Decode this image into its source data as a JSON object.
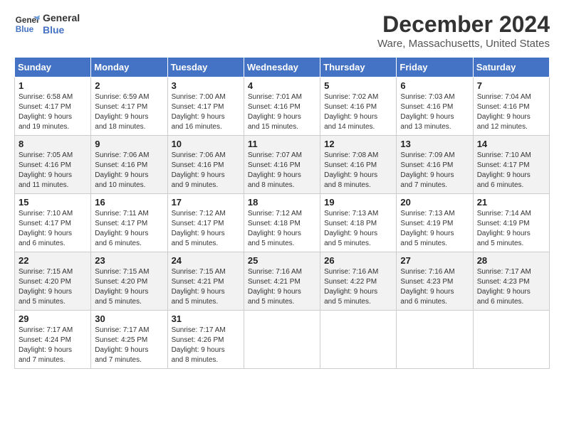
{
  "header": {
    "logo_line1": "General",
    "logo_line2": "Blue",
    "title": "December 2024",
    "subtitle": "Ware, Massachusetts, United States"
  },
  "weekdays": [
    "Sunday",
    "Monday",
    "Tuesday",
    "Wednesday",
    "Thursday",
    "Friday",
    "Saturday"
  ],
  "weeks": [
    [
      {
        "day": "1",
        "info": "Sunrise: 6:58 AM\nSunset: 4:17 PM\nDaylight: 9 hours\nand 19 minutes."
      },
      {
        "day": "2",
        "info": "Sunrise: 6:59 AM\nSunset: 4:17 PM\nDaylight: 9 hours\nand 18 minutes."
      },
      {
        "day": "3",
        "info": "Sunrise: 7:00 AM\nSunset: 4:17 PM\nDaylight: 9 hours\nand 16 minutes."
      },
      {
        "day": "4",
        "info": "Sunrise: 7:01 AM\nSunset: 4:16 PM\nDaylight: 9 hours\nand 15 minutes."
      },
      {
        "day": "5",
        "info": "Sunrise: 7:02 AM\nSunset: 4:16 PM\nDaylight: 9 hours\nand 14 minutes."
      },
      {
        "day": "6",
        "info": "Sunrise: 7:03 AM\nSunset: 4:16 PM\nDaylight: 9 hours\nand 13 minutes."
      },
      {
        "day": "7",
        "info": "Sunrise: 7:04 AM\nSunset: 4:16 PM\nDaylight: 9 hours\nand 12 minutes."
      }
    ],
    [
      {
        "day": "8",
        "info": "Sunrise: 7:05 AM\nSunset: 4:16 PM\nDaylight: 9 hours\nand 11 minutes."
      },
      {
        "day": "9",
        "info": "Sunrise: 7:06 AM\nSunset: 4:16 PM\nDaylight: 9 hours\nand 10 minutes."
      },
      {
        "day": "10",
        "info": "Sunrise: 7:06 AM\nSunset: 4:16 PM\nDaylight: 9 hours\nand 9 minutes."
      },
      {
        "day": "11",
        "info": "Sunrise: 7:07 AM\nSunset: 4:16 PM\nDaylight: 9 hours\nand 8 minutes."
      },
      {
        "day": "12",
        "info": "Sunrise: 7:08 AM\nSunset: 4:16 PM\nDaylight: 9 hours\nand 8 minutes."
      },
      {
        "day": "13",
        "info": "Sunrise: 7:09 AM\nSunset: 4:16 PM\nDaylight: 9 hours\nand 7 minutes."
      },
      {
        "day": "14",
        "info": "Sunrise: 7:10 AM\nSunset: 4:17 PM\nDaylight: 9 hours\nand 6 minutes."
      }
    ],
    [
      {
        "day": "15",
        "info": "Sunrise: 7:10 AM\nSunset: 4:17 PM\nDaylight: 9 hours\nand 6 minutes."
      },
      {
        "day": "16",
        "info": "Sunrise: 7:11 AM\nSunset: 4:17 PM\nDaylight: 9 hours\nand 6 minutes."
      },
      {
        "day": "17",
        "info": "Sunrise: 7:12 AM\nSunset: 4:17 PM\nDaylight: 9 hours\nand 5 minutes."
      },
      {
        "day": "18",
        "info": "Sunrise: 7:12 AM\nSunset: 4:18 PM\nDaylight: 9 hours\nand 5 minutes."
      },
      {
        "day": "19",
        "info": "Sunrise: 7:13 AM\nSunset: 4:18 PM\nDaylight: 9 hours\nand 5 minutes."
      },
      {
        "day": "20",
        "info": "Sunrise: 7:13 AM\nSunset: 4:19 PM\nDaylight: 9 hours\nand 5 minutes."
      },
      {
        "day": "21",
        "info": "Sunrise: 7:14 AM\nSunset: 4:19 PM\nDaylight: 9 hours\nand 5 minutes."
      }
    ],
    [
      {
        "day": "22",
        "info": "Sunrise: 7:15 AM\nSunset: 4:20 PM\nDaylight: 9 hours\nand 5 minutes."
      },
      {
        "day": "23",
        "info": "Sunrise: 7:15 AM\nSunset: 4:20 PM\nDaylight: 9 hours\nand 5 minutes."
      },
      {
        "day": "24",
        "info": "Sunrise: 7:15 AM\nSunset: 4:21 PM\nDaylight: 9 hours\nand 5 minutes."
      },
      {
        "day": "25",
        "info": "Sunrise: 7:16 AM\nSunset: 4:21 PM\nDaylight: 9 hours\nand 5 minutes."
      },
      {
        "day": "26",
        "info": "Sunrise: 7:16 AM\nSunset: 4:22 PM\nDaylight: 9 hours\nand 5 minutes."
      },
      {
        "day": "27",
        "info": "Sunrise: 7:16 AM\nSunset: 4:23 PM\nDaylight: 9 hours\nand 6 minutes."
      },
      {
        "day": "28",
        "info": "Sunrise: 7:17 AM\nSunset: 4:23 PM\nDaylight: 9 hours\nand 6 minutes."
      }
    ],
    [
      {
        "day": "29",
        "info": "Sunrise: 7:17 AM\nSunset: 4:24 PM\nDaylight: 9 hours\nand 7 minutes."
      },
      {
        "day": "30",
        "info": "Sunrise: 7:17 AM\nSunset: 4:25 PM\nDaylight: 9 hours\nand 7 minutes."
      },
      {
        "day": "31",
        "info": "Sunrise: 7:17 AM\nSunset: 4:26 PM\nDaylight: 9 hours\nand 8 minutes."
      },
      null,
      null,
      null,
      null
    ]
  ]
}
